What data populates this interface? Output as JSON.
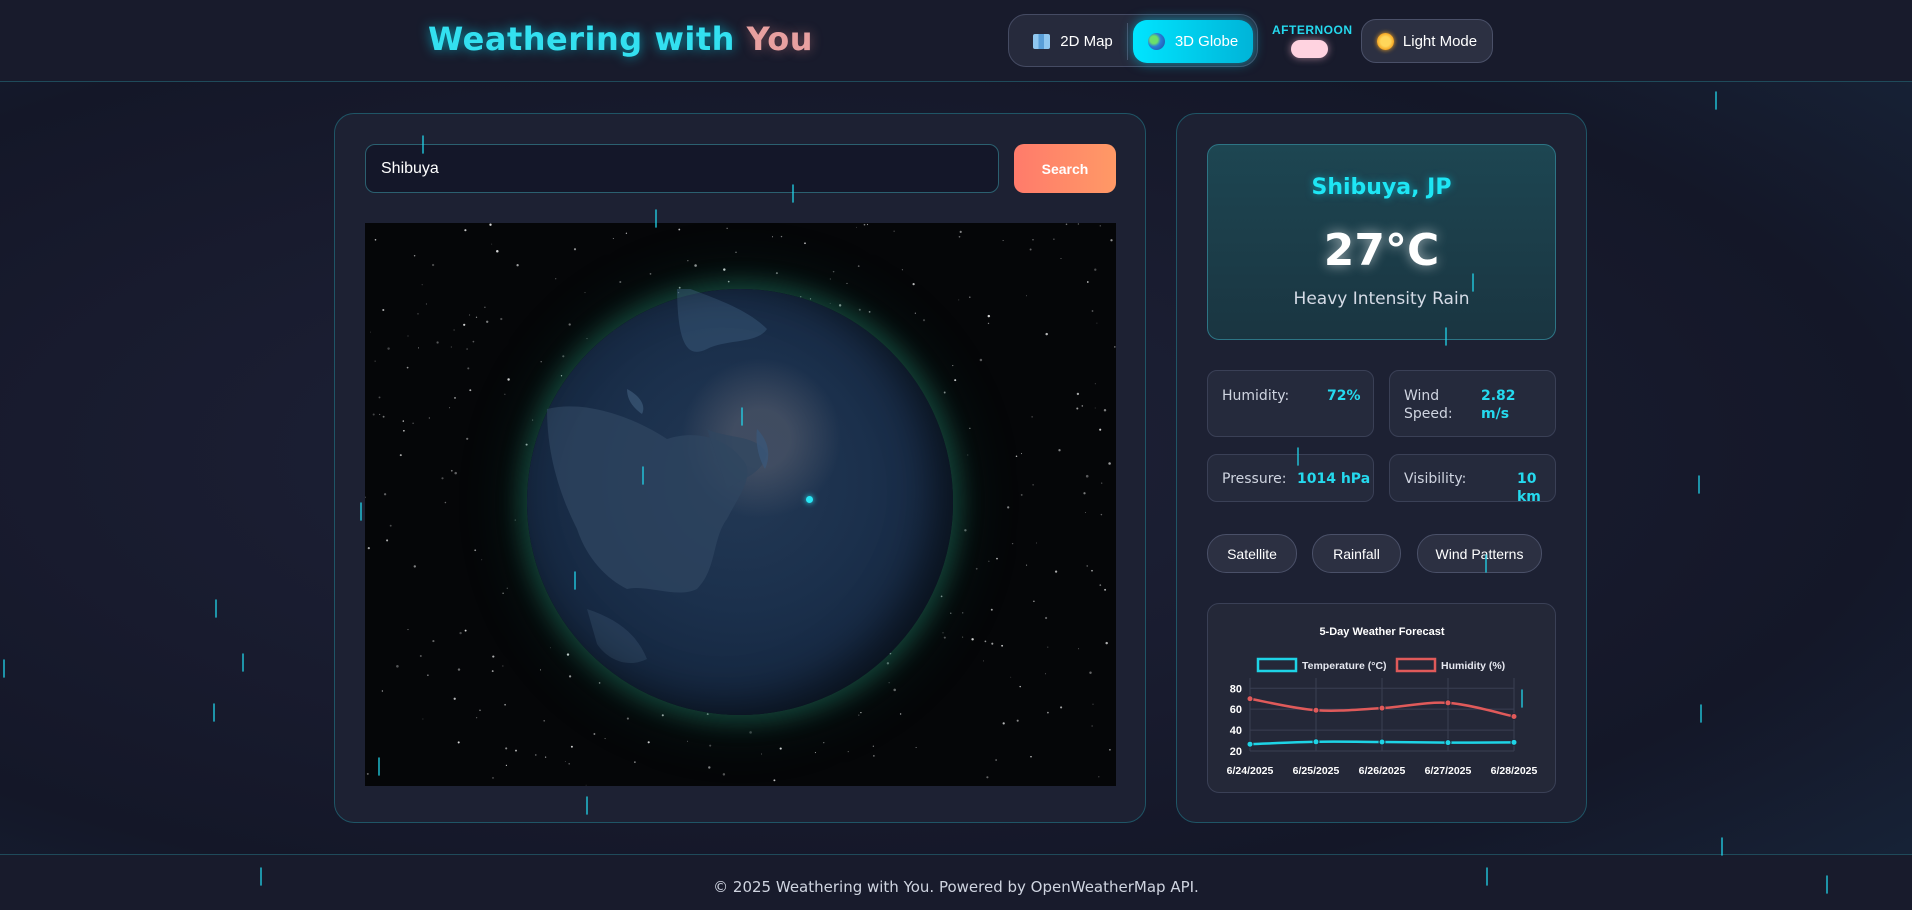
{
  "header": {
    "title_part1": "Weathering with ",
    "title_part2": "You",
    "view_toggle": {
      "map2d_label": "2D Map",
      "map2d_icon": "map-icon",
      "globe3d_label": "3D Globe",
      "globe3d_icon": "globe-icon",
      "active": "3D Globe"
    },
    "time_of_day": "AFTERNOON",
    "light_mode_label": "Light Mode",
    "light_mode_icon": "sun-icon"
  },
  "search": {
    "value": "Shibuya",
    "button_label": "Search"
  },
  "weather": {
    "location": "Shibuya, JP",
    "temperature": "27°C",
    "condition": "Heavy Intensity Rain",
    "stats": {
      "humidity_label": "Humidity:",
      "humidity_value": "72%",
      "wind_label_1": "Wind",
      "wind_label_2": "Speed:",
      "wind_value_1": "2.82",
      "wind_value_2": "m/s",
      "pressure_label": "Pressure:",
      "pressure_value": "1014 hPa",
      "visibility_label": "Visibility:",
      "visibility_value": "10 km"
    }
  },
  "layers": [
    "Satellite",
    "Rainfall",
    "Wind Patterns"
  ],
  "chart_data": {
    "type": "line",
    "title": "5-Day Weather Forecast",
    "categories": [
      "6/24/2025",
      "6/25/2025",
      "6/26/2025",
      "6/27/2025",
      "6/28/2025"
    ],
    "series": [
      {
        "name": "Temperature (°C)",
        "color": "#1ed4e6",
        "values": [
          26.5,
          28.8,
          28.6,
          28.0,
          28.3
        ]
      },
      {
        "name": "Humidity (%)",
        "color": "#e05a5a",
        "values": [
          70,
          59,
          61,
          66,
          53
        ]
      }
    ],
    "yticks": [
      20,
      40,
      60,
      80
    ],
    "ylim": [
      20,
      86
    ],
    "grid": true,
    "legend": "top"
  },
  "footer": {
    "text": "© 2025 Weathering with You. Powered by OpenWeatherMap API."
  },
  "colors": {
    "accent": "#1ee6f5",
    "search_button": "#ff8a68",
    "background": "#181b2e"
  }
}
